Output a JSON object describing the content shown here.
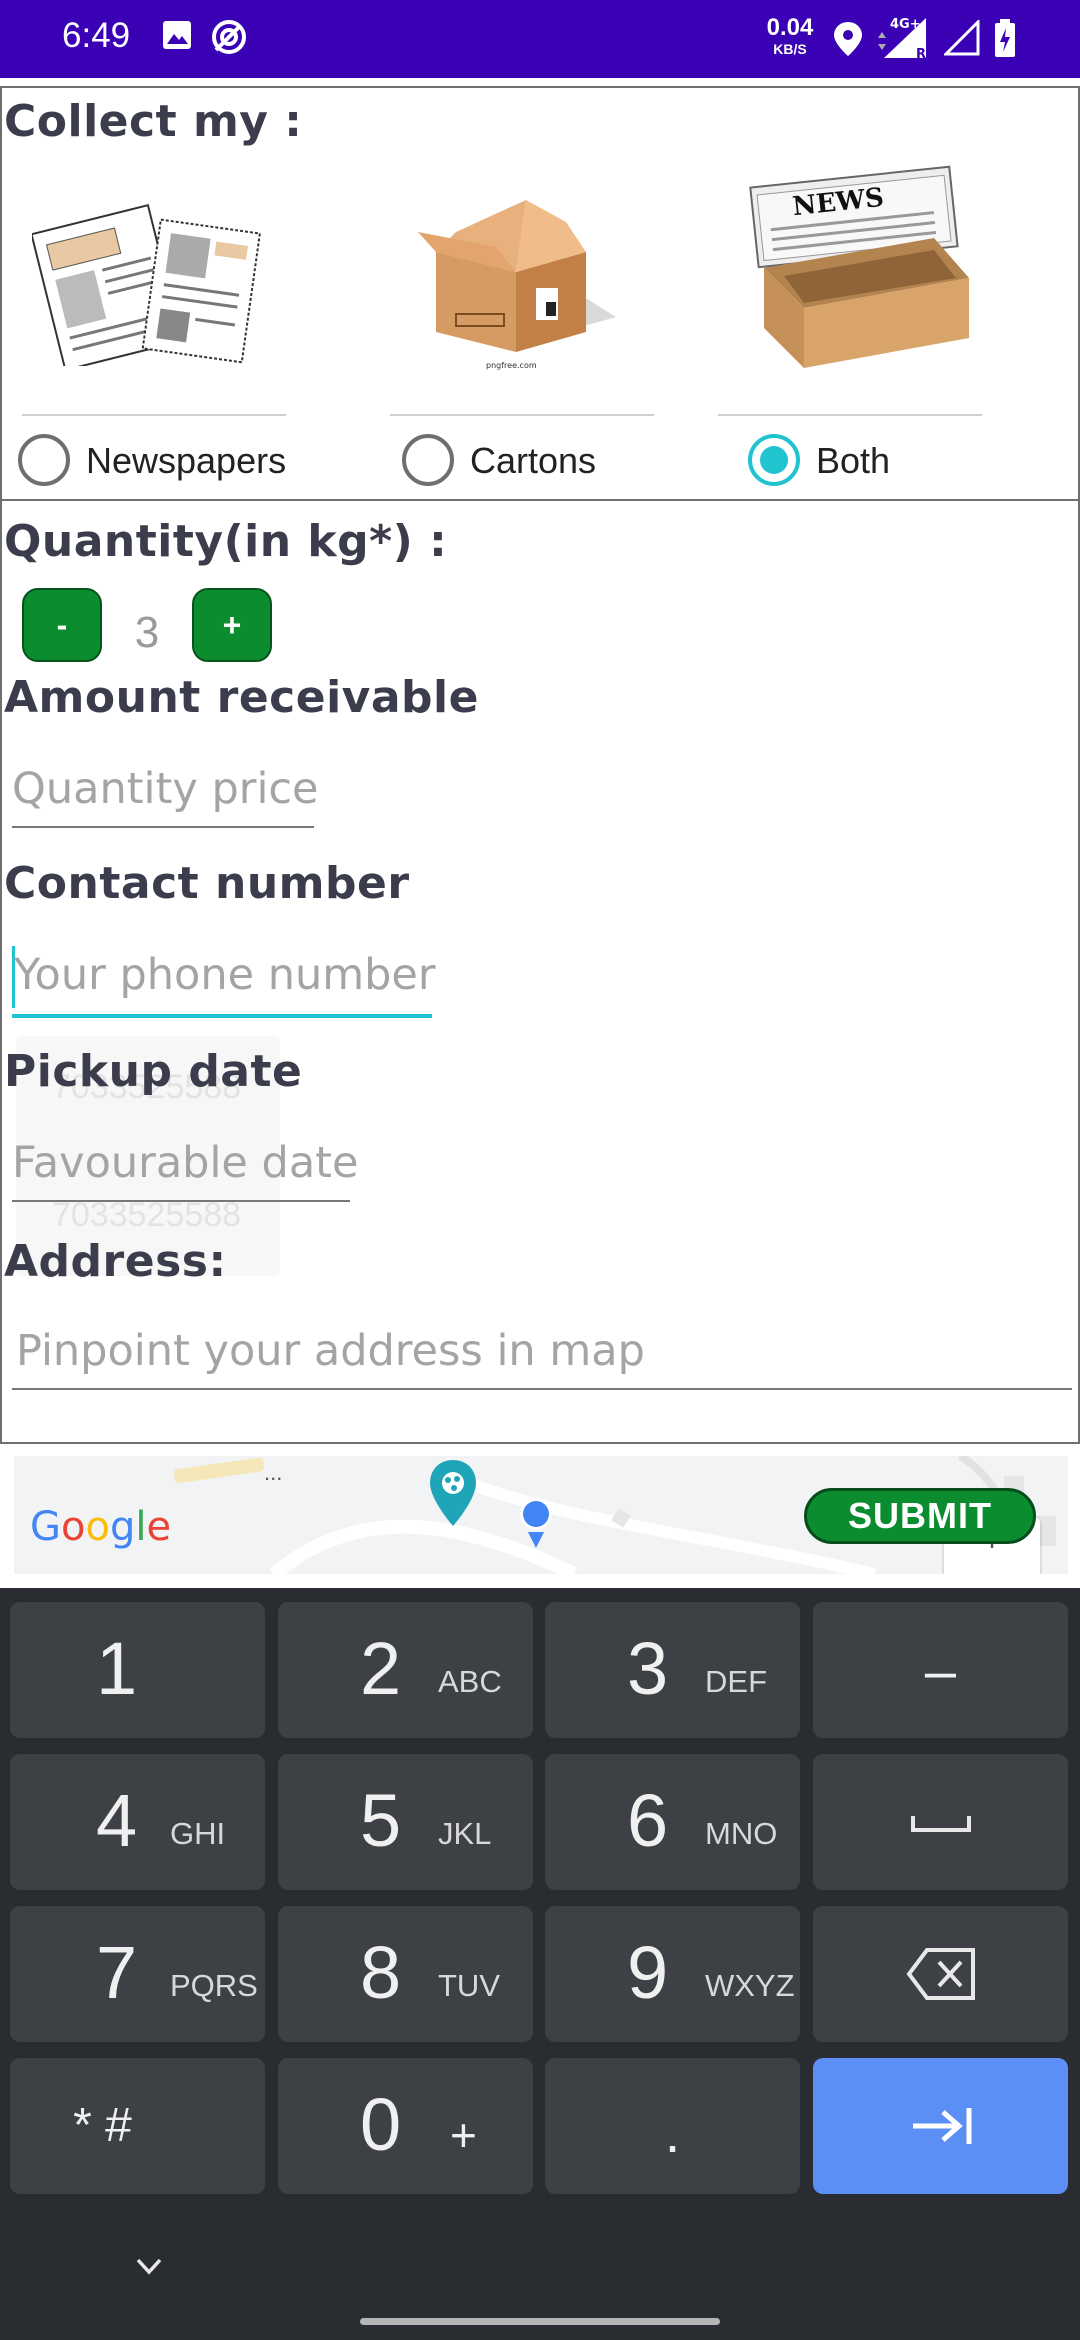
{
  "status_bar": {
    "time": "6:49",
    "net_speed_value": "0.04",
    "net_speed_unit": "KB/S",
    "icons": [
      "image-icon",
      "hotspot-icon",
      "location-icon",
      "signal-4g-icon",
      "signal-icon",
      "battery-charging-icon"
    ],
    "network_label": "4G+",
    "roaming_label": "R"
  },
  "collect": {
    "title": "Collect my :",
    "options": [
      {
        "label": "Newspapers",
        "selected": false,
        "image": "newspapers-image"
      },
      {
        "label": "Cartons",
        "selected": false,
        "image": "carton-box-image",
        "watermark": "pngfree.com"
      },
      {
        "label": "Both",
        "selected": true,
        "image": "news-in-box-image"
      }
    ]
  },
  "quantity": {
    "label": "Quantity(in kg*) :",
    "minus_label": "-",
    "plus_label": "+",
    "value": "3"
  },
  "amount": {
    "label": "Amount receivable",
    "placeholder": "Quantity price"
  },
  "contact": {
    "label": "Contact number",
    "placeholder": "Your phone number",
    "suggestions": [
      "7033525588",
      "7033525588"
    ]
  },
  "pickup": {
    "label": "Pickup date",
    "placeholder": "Favourable date"
  },
  "address": {
    "label": "Address:",
    "placeholder": "Pinpoint your address in map"
  },
  "map": {
    "logo": "Google",
    "submit_label": "SUBMIT",
    "plus_label": "+",
    "dots": "...",
    "colors": {
      "accent": "#1fc4cf",
      "button": "#0a8c2f",
      "status_bar": "#3a02b4"
    }
  },
  "keyboard": {
    "rows": [
      [
        {
          "digit": "1",
          "letters": ""
        },
        {
          "digit": "2",
          "letters": "ABC"
        },
        {
          "digit": "3",
          "letters": "DEF"
        },
        {
          "sym": "–",
          "name": "minus-key"
        }
      ],
      [
        {
          "digit": "4",
          "letters": "GHI"
        },
        {
          "digit": "5",
          "letters": "JKL"
        },
        {
          "digit": "6",
          "letters": "MNO"
        },
        {
          "sym": "␣",
          "name": "space-key"
        }
      ],
      [
        {
          "digit": "7",
          "letters": "PQRS"
        },
        {
          "digit": "8",
          "letters": "TUV"
        },
        {
          "digit": "9",
          "letters": "WXYZ"
        },
        {
          "sym": "",
          "name": "backspace-key"
        }
      ],
      [
        {
          "sym": "* #",
          "name": "symbols-key"
        },
        {
          "digit": "0",
          "letters": "+"
        },
        {
          "sym": ".",
          "name": "period-key"
        },
        {
          "sym": "",
          "name": "next-key"
        }
      ]
    ]
  }
}
